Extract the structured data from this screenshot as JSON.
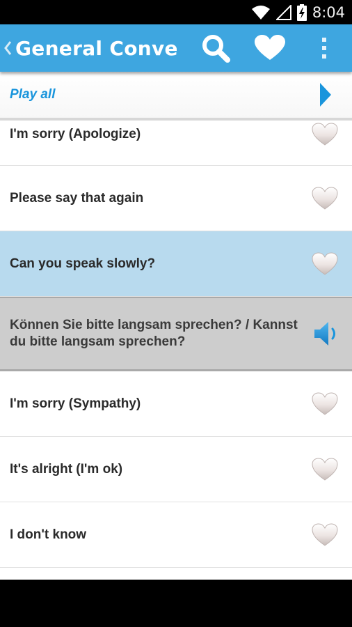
{
  "status_bar": {
    "time": "8:04"
  },
  "action_bar": {
    "title": "General Conve…"
  },
  "play_all": {
    "label": "Play all"
  },
  "rows": [
    {
      "text": "I'm sorry (Apologize)",
      "type": "phrase"
    },
    {
      "text": "Please say that again",
      "type": "phrase"
    },
    {
      "text": "Can you speak slowly?",
      "type": "phrase",
      "selected": true
    },
    {
      "text": "Können Sie bitte langsam sprechen? / Kannst du bitte langsam sprechen?",
      "type": "translation"
    },
    {
      "text": "I'm sorry (Sympathy)",
      "type": "phrase"
    },
    {
      "text": "It's alright (I'm ok)",
      "type": "phrase"
    },
    {
      "text": "I don't know",
      "type": "phrase"
    }
  ],
  "colors": {
    "action_bar": "#3ea6e0",
    "play_all_text": "#1a95dc",
    "selected_row": "#b8daee",
    "translation_row": "#cdcdcd",
    "speaker": "#1a95dc"
  },
  "icons": {
    "status": [
      "wifi-icon",
      "signal-icon",
      "battery-charging-icon"
    ],
    "action_bar": [
      "back-chevron-icon",
      "search-icon",
      "favorites-heart-icon",
      "overflow-menu-icon"
    ],
    "rows": [
      "heart-icon",
      "speaker-icon"
    ],
    "play_all": "play-triangle-icon"
  }
}
